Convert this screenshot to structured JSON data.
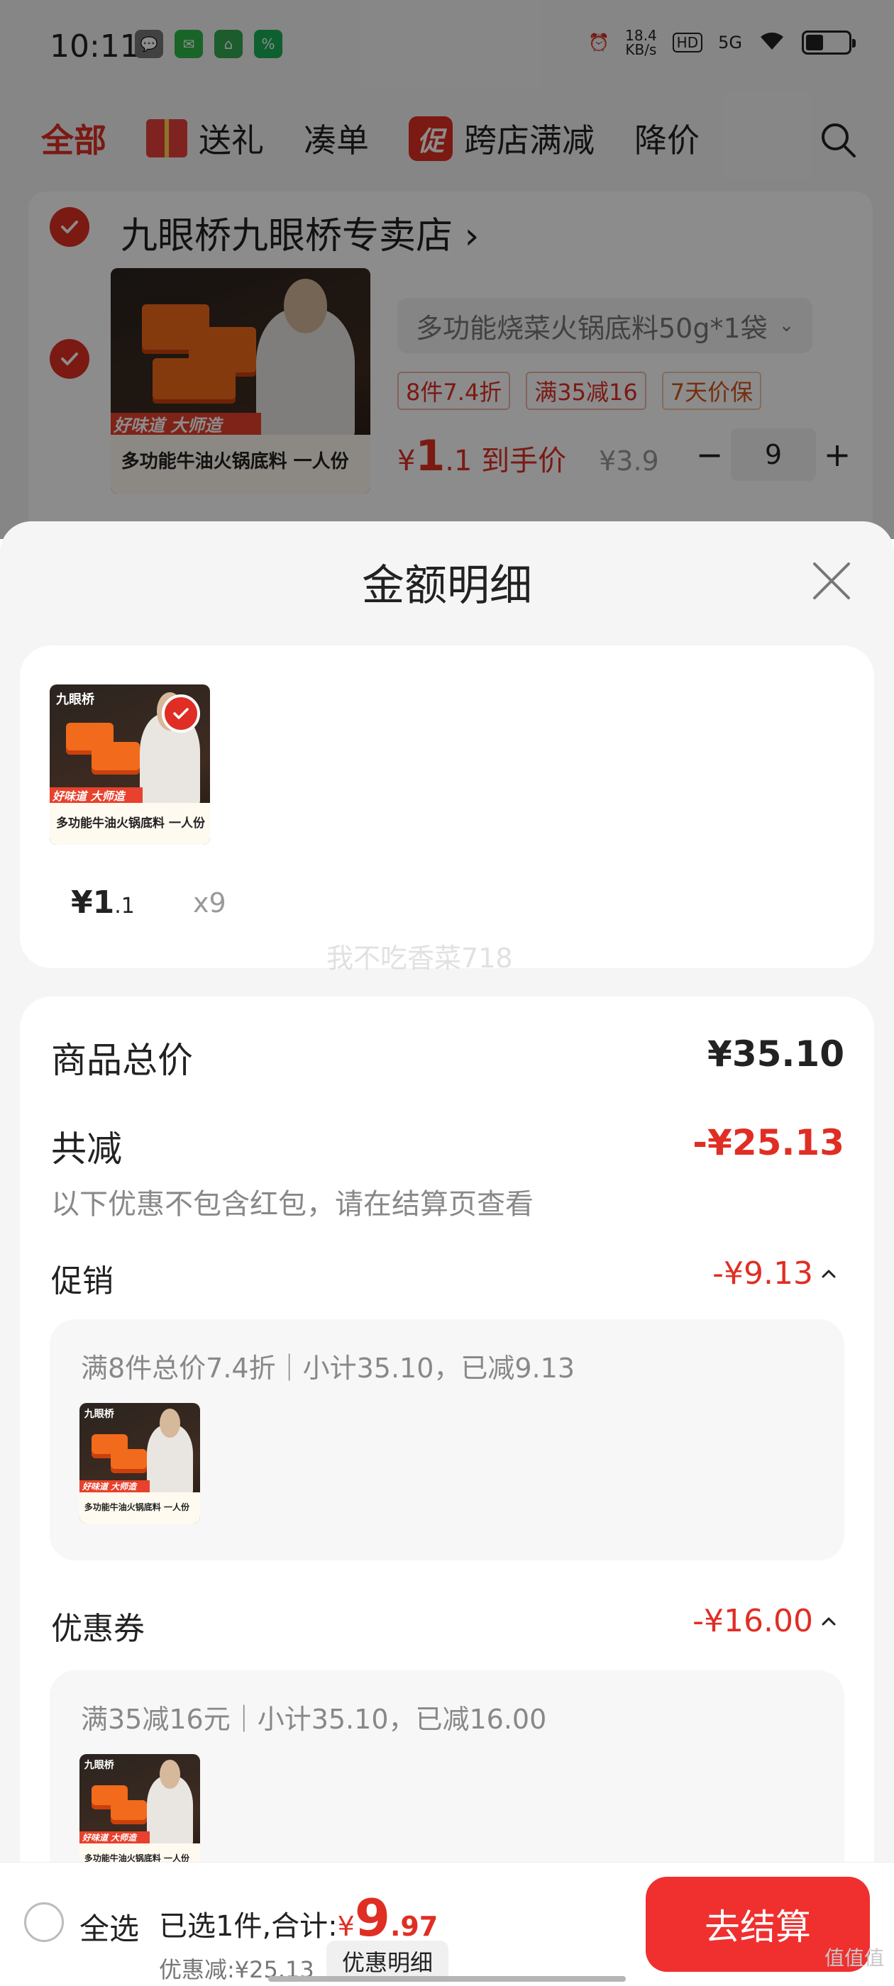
{
  "status_bar": {
    "time": "10:11",
    "net_speed_value": "18.4",
    "net_speed_unit": "KB/s",
    "hd": "HD",
    "signal": "5G"
  },
  "tabs": [
    {
      "label": "全部",
      "active": true
    },
    {
      "label": "送礼",
      "active": false
    },
    {
      "label": "凑单",
      "active": false
    },
    {
      "label": "跨店满减",
      "badge": "促",
      "active": false
    },
    {
      "label": "降价",
      "active": false
    }
  ],
  "store": {
    "name": "九眼桥九眼桥专卖店",
    "arrow": "›"
  },
  "cart_item": {
    "spec": "多功能烧菜火锅底料50g*1袋",
    "tags": [
      "8件7.4折",
      "满35减16",
      "7天价保"
    ],
    "price_symbol": "¥",
    "price_int": "1",
    "price_dec": ".1",
    "price_suffix": "到手价",
    "original_price": "¥3.9",
    "quantity": "9",
    "minus": "−",
    "plus": "+"
  },
  "product_image": {
    "brand": "九眼桥",
    "banner_red": "好味道 大师造",
    "banner_text": "多功能牛油火锅底料 一人份"
  },
  "sheet": {
    "title": "金额明细",
    "summary": {
      "price_main": "¥1",
      "price_dec": ".1",
      "qty": "x9",
      "watermark": "我不吃香菜718"
    },
    "total_label": "商品总价",
    "total_value": "¥35.10",
    "reduce_label": "共减",
    "reduce_value": "-¥25.13",
    "note": "以下优惠不包含红包，请在结算页查看",
    "promo": {
      "label": "促销",
      "value": "-¥9.13",
      "detail": "满8件总价7.4折｜小计35.10，已减9.13"
    },
    "coupon": {
      "label": "优惠券",
      "value": "-¥16.00",
      "detail": "满35减16元｜小计35.10，已减16.00"
    }
  },
  "footer": {
    "select_all": "全选",
    "selected_text": "已选1件,合计:",
    "yen": "¥",
    "total_int": "9",
    "total_dec": ".97",
    "discount_text": "优惠减:¥25.13",
    "detail_button": "优惠明细",
    "checkout_button": "去结算",
    "corner_logo": "值值值"
  },
  "colors": {
    "accent_red": "#e02e24",
    "checkout_red": "#f02f2f"
  }
}
